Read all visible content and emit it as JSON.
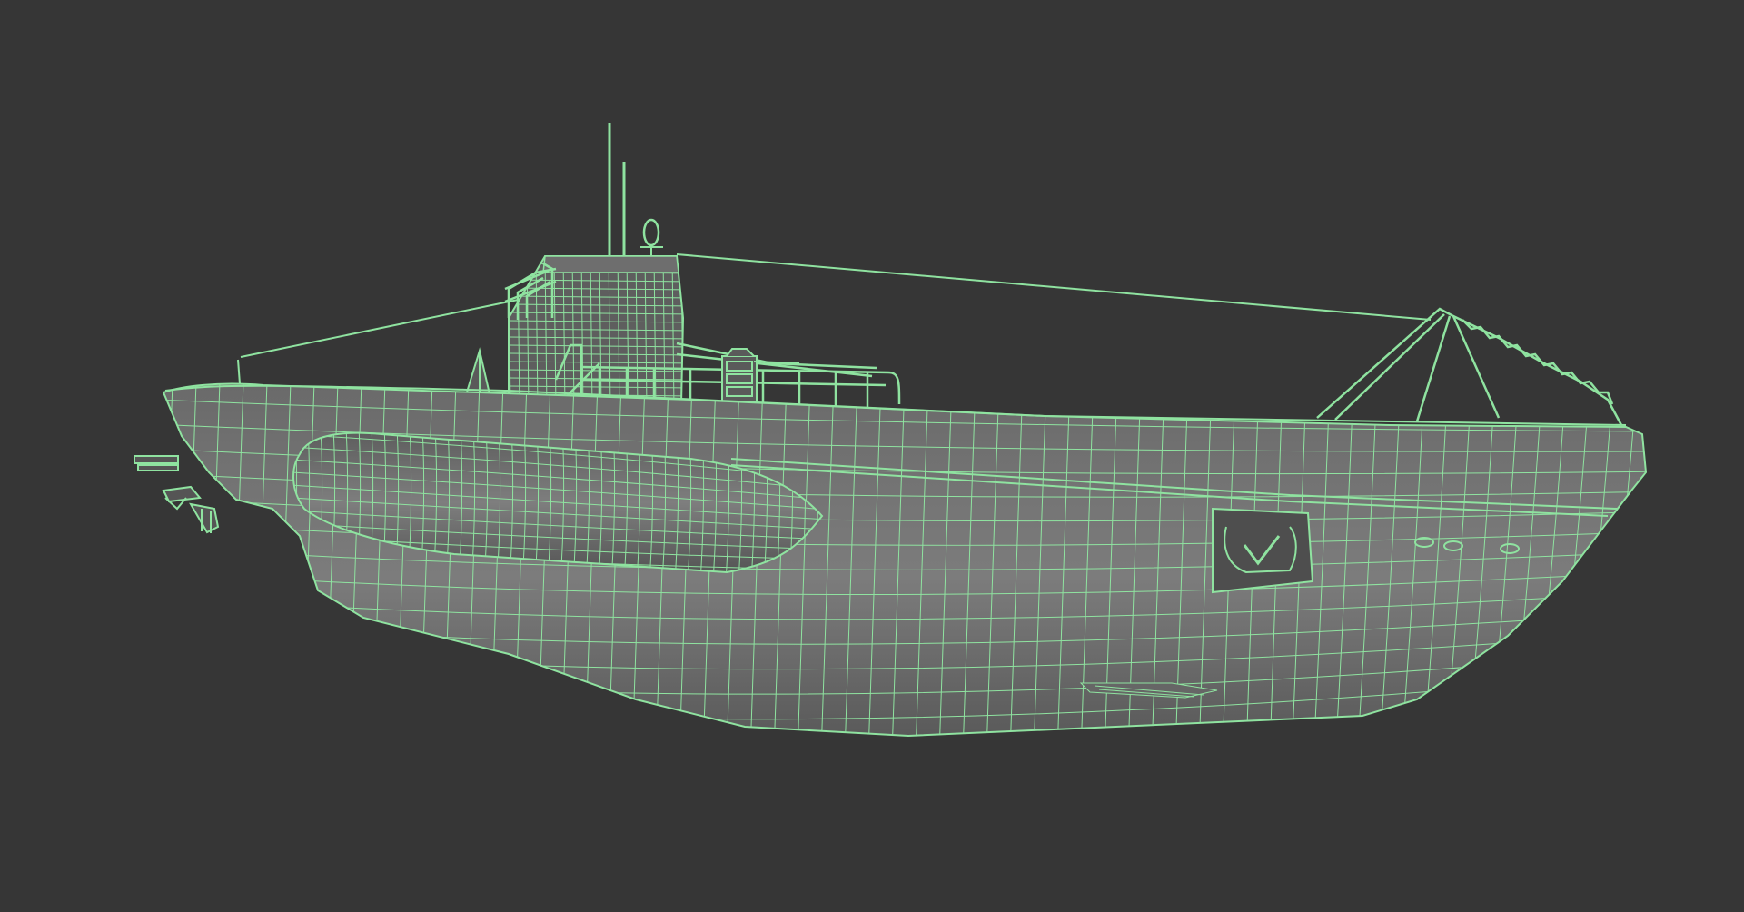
{
  "viewport": {
    "background_color": "#363636",
    "wire_color": "#8fe3a0",
    "hull_fill_color": "#5c5c5c",
    "hull_shade_color": "#7a7a7a",
    "render_mode": "wireframe-on-shaded"
  },
  "model": {
    "subject": "submarine",
    "parts": [
      "hull",
      "conning-tower",
      "periscopes",
      "deck-railing",
      "deck-gun",
      "saddle-tank",
      "bow-net-cutter",
      "anchor-recess",
      "stern-propellers",
      "jumping-wire"
    ]
  }
}
